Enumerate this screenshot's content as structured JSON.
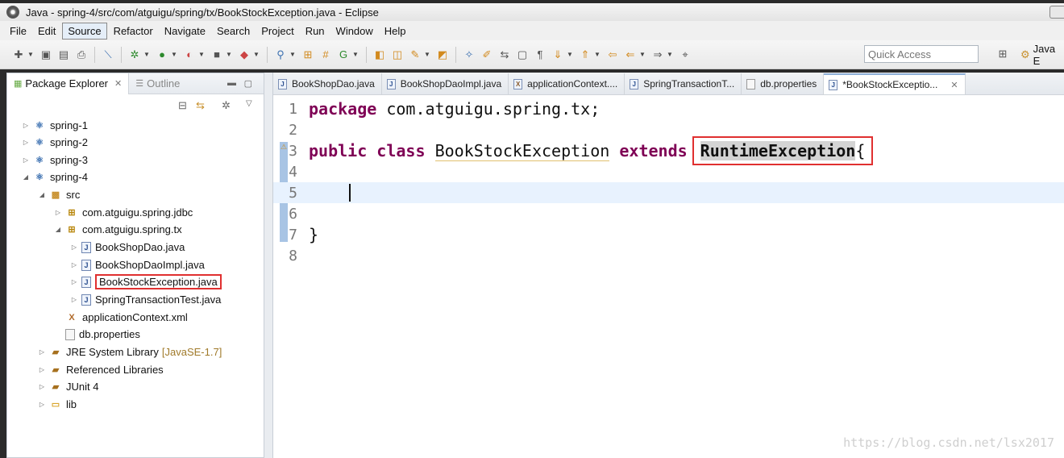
{
  "window": {
    "title": "Java - spring-4/src/com/atguigu/spring/tx/BookStockException.java - Eclipse"
  },
  "menu": [
    "File",
    "Edit",
    "Source",
    "Refactor",
    "Navigate",
    "Search",
    "Project",
    "Run",
    "Window",
    "Help"
  ],
  "menu_active": "Source",
  "toolbar": {
    "quick_access_placeholder": "Quick Access",
    "perspective": "Java E"
  },
  "left_panel": {
    "tabs": [
      {
        "label": "Package Explorer",
        "active": true
      },
      {
        "label": "Outline",
        "active": false
      }
    ],
    "tree": [
      {
        "label": "spring-1",
        "type": "project"
      },
      {
        "label": "spring-2",
        "type": "project"
      },
      {
        "label": "spring-3",
        "type": "project"
      },
      {
        "label": "spring-4",
        "type": "project"
      },
      {
        "label": "src",
        "type": "src"
      },
      {
        "label": "com.atguigu.spring.jdbc",
        "type": "package"
      },
      {
        "label": "com.atguigu.spring.tx",
        "type": "package"
      },
      {
        "label": "BookShopDao.java",
        "type": "java"
      },
      {
        "label": "BookShopDaoImpl.java",
        "type": "java"
      },
      {
        "label": "BookStockException.java",
        "type": "java"
      },
      {
        "label": "SpringTransactionTest.java",
        "type": "java"
      },
      {
        "label": "applicationContext.xml",
        "type": "xml"
      },
      {
        "label": "db.properties",
        "type": "file"
      },
      {
        "label": "JRE System Library",
        "extra": "[JavaSE-1.7]",
        "type": "lib"
      },
      {
        "label": "Referenced Libraries",
        "type": "lib"
      },
      {
        "label": "JUnit 4",
        "type": "lib"
      },
      {
        "label": "lib",
        "type": "folder"
      }
    ]
  },
  "editor": {
    "tabs": [
      {
        "label": "BookShopDao.java",
        "active": false
      },
      {
        "label": "BookShopDaoImpl.java",
        "active": false
      },
      {
        "label": "applicationContext....",
        "active": false
      },
      {
        "label": "SpringTransactionT...",
        "active": false
      },
      {
        "label": "db.properties",
        "active": false
      },
      {
        "label": "*BookStockExceptio...",
        "active": true
      }
    ],
    "lines": {
      "n1": "1",
      "n2": "2",
      "n3": "3",
      "n4": "4",
      "n5": "5",
      "n6": "6",
      "n7": "7",
      "n8": "8",
      "l1_kw": "package",
      "l1_rest": " com.atguigu.spring.tx;",
      "l3_kw1": "public",
      "l3_kw2": "class",
      "l3_cls": "BookStockException",
      "l3_kw3": "extends",
      "l3_super": "RuntimeException",
      "l3_brace": "{",
      "l7": "}"
    }
  },
  "watermark": "https://blog.csdn.net/lsx2017"
}
